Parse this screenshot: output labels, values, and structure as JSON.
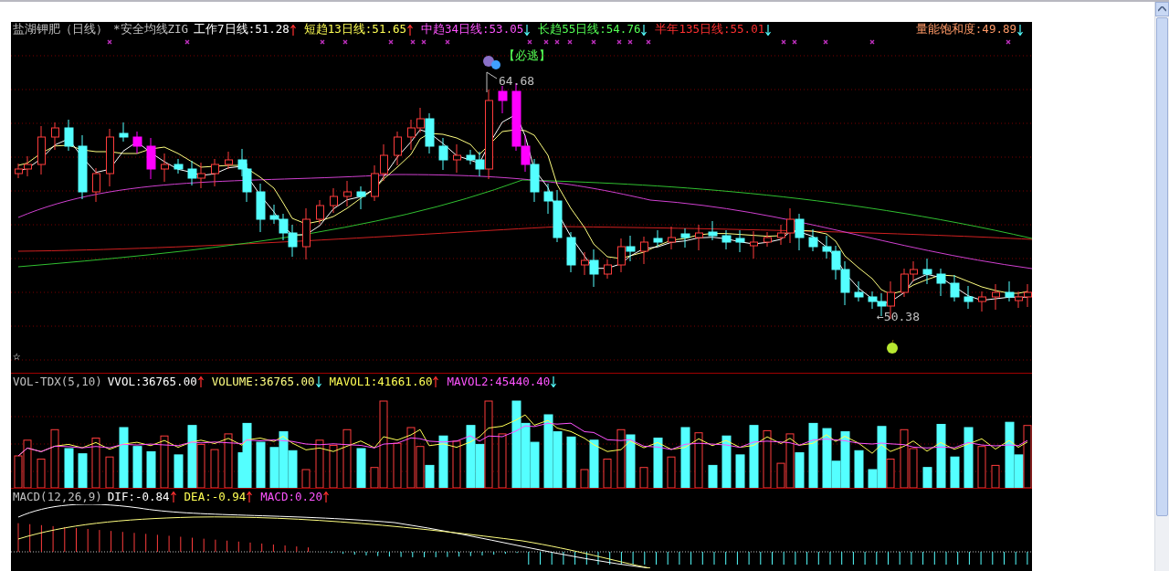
{
  "main_pane": {
    "title": "盐湖钾肥（日线）",
    "indicator": "*安全均线ZIG",
    "legend": [
      {
        "label": "工作7日线:51.28",
        "color": "#ffffff",
        "rising": true
      },
      {
        "label": "短趋13日线:51.65",
        "color": "#ffff54",
        "rising": true
      },
      {
        "label": "中趋34日线:53.05",
        "color": "#ff54ff",
        "rising": false
      },
      {
        "label": "长趋55日线:54.76",
        "color": "#54ff54",
        "rising": false
      },
      {
        "label": "半年135日线:55.01",
        "color": "#ff3030",
        "rising": false
      }
    ],
    "saturation": {
      "label": "量能饱和度:49.89",
      "color": "#ff9966",
      "rising": false
    },
    "annotations": [
      {
        "kind": "signal",
        "text": "【必逃】"
      },
      {
        "kind": "high",
        "text": "64.68"
      },
      {
        "kind": "low",
        "text": "←50.38"
      }
    ],
    "marker": "☆"
  },
  "volume_pane": {
    "title": "VOL-TDX(5,10)",
    "legend": [
      {
        "label": "VVOL:36765.00",
        "color": "#ffffff",
        "rising": true
      },
      {
        "label": "VOLUME:36765.00",
        "color": "#ffff80",
        "rising": false
      },
      {
        "label": "MAVOL1:41661.60",
        "color": "#ffff54",
        "rising": true
      },
      {
        "label": "MAVOL2:45440.40",
        "color": "#ff54ff",
        "rising": false
      }
    ]
  },
  "macd_pane": {
    "title": "MACD(12,26,9)",
    "legend": [
      {
        "label": "DIF:-0.84",
        "color": "#ffffff",
        "rising": true
      },
      {
        "label": "DEA:-0.94",
        "color": "#ffff54",
        "rising": true
      },
      {
        "label": "MACD:0.20",
        "color": "#ff54ff",
        "rising": true
      }
    ]
  }
}
